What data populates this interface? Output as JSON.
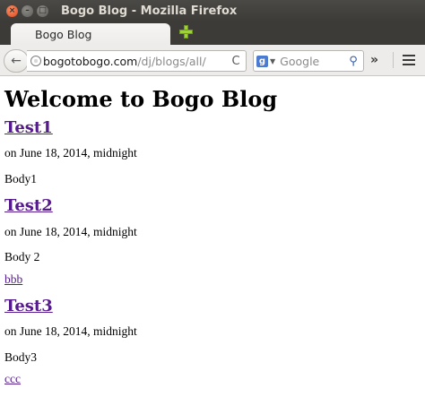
{
  "window": {
    "title": "Bogo Blog - Mozilla Firefox",
    "controls": {
      "close": "×",
      "minimize": "–",
      "maximize": "□"
    }
  },
  "tabs": [
    {
      "label": "Bogo Blog",
      "active": true
    }
  ],
  "navbar": {
    "back_icon": "←",
    "url_host": "bogotobogo.com",
    "url_path": "/dj/blogs/all/",
    "reload_icon": "C",
    "search_engine_icon": "g",
    "search_placeholder": "Google",
    "search_icon": "⚲",
    "overflow_icon": "»"
  },
  "page": {
    "heading": "Welcome to Bogo Blog",
    "posts": [
      {
        "title": "Test1",
        "meta": "on June 18, 2014, midnight",
        "body": "Body1",
        "tag": ""
      },
      {
        "title": "Test2",
        "meta": "on June 18, 2014, midnight",
        "body": "Body 2",
        "tag": "bbb"
      },
      {
        "title": "Test3",
        "meta": "on June 18, 2014, midnight",
        "body": "Body3",
        "tag": "ccc"
      }
    ]
  },
  "colors": {
    "link_visited": "#551a8b",
    "titlebar": "#3c3b37",
    "toolbar": "#edecea"
  }
}
